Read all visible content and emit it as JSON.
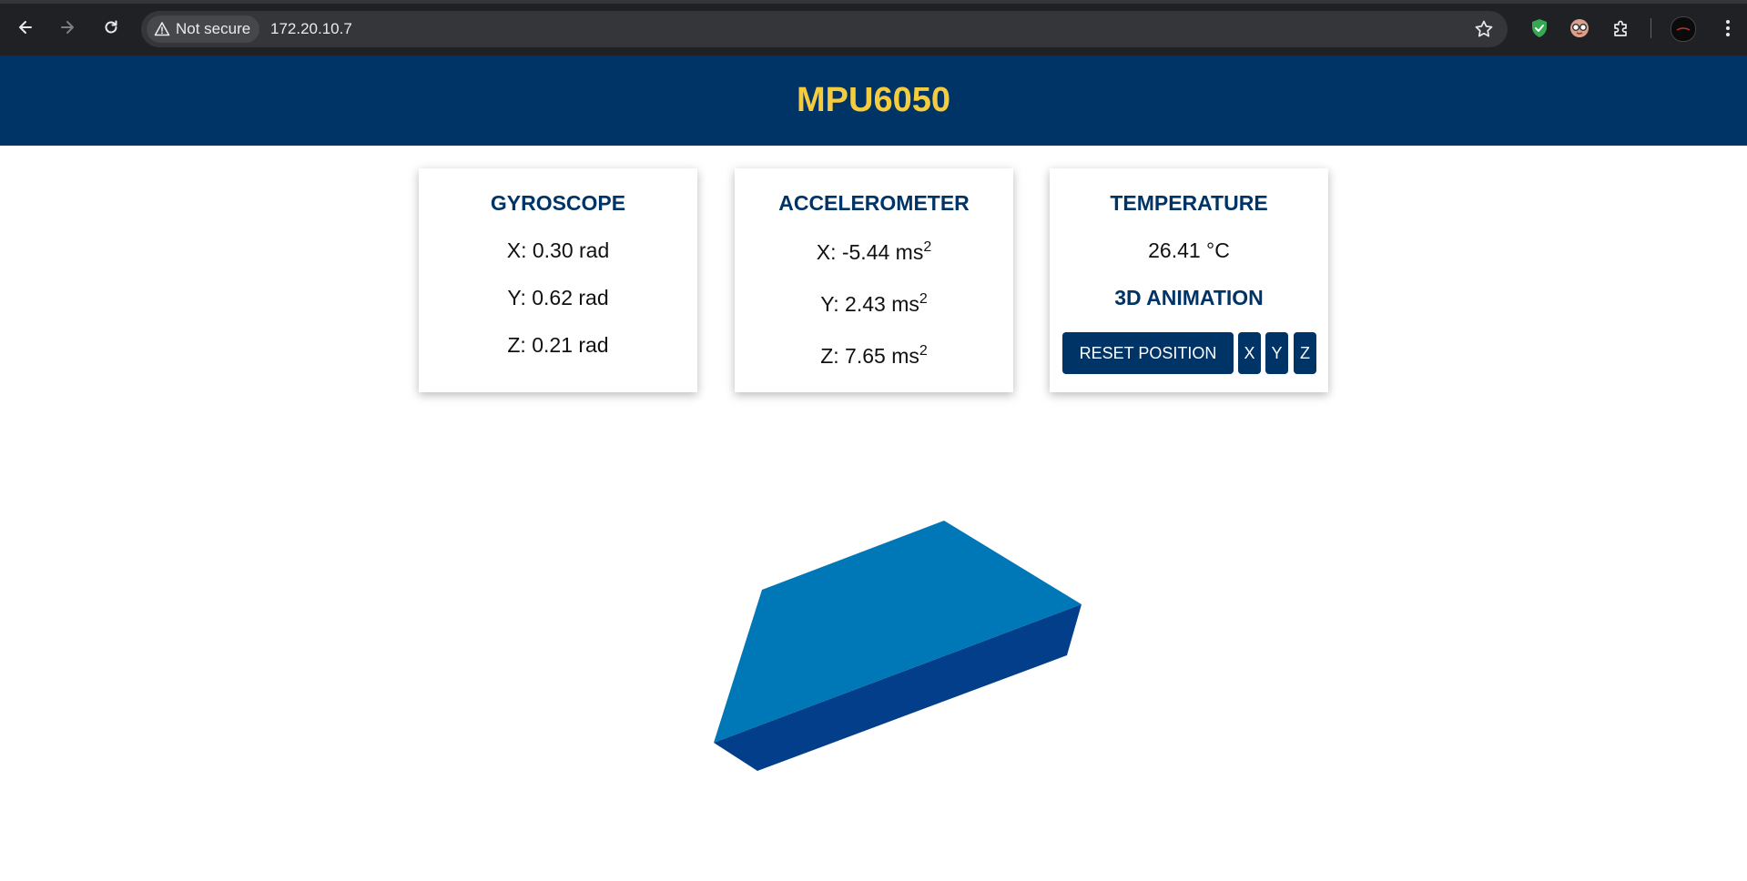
{
  "browser": {
    "security_label": "Not secure",
    "url": "172.20.10.7"
  },
  "page": {
    "title": "MPU6050",
    "gyroscope": {
      "heading": "GYROSCOPE",
      "x": "X: 0.30 rad",
      "y": "Y: 0.62 rad",
      "z": "Z: 0.21 rad"
    },
    "accelerometer": {
      "heading": "ACCELEROMETER",
      "x": "X: -5.44 ms",
      "y": "Y: 2.43 ms",
      "z": "Z: 7.65 ms",
      "unit_exponent": "2"
    },
    "temperature": {
      "heading": "TEMPERATURE",
      "value": "26.41 °C"
    },
    "animation": {
      "heading": "3D ANIMATION",
      "reset_label": "RESET POSITION",
      "x_label": "X",
      "y_label": "Y",
      "z_label": "Z"
    }
  },
  "colors": {
    "header_bg": "#003366",
    "title": "#f5cc3d",
    "heading": "#003366",
    "cube_top": "#0077b6",
    "cube_side": "#023e8a"
  },
  "icons": [
    "back-arrow-icon",
    "forward-arrow-icon",
    "reload-icon",
    "warning-icon",
    "star-icon",
    "shield-check-extension-icon",
    "glasses-extension-icon",
    "puzzle-icon",
    "profile-avatar",
    "kebab-menu-icon"
  ]
}
